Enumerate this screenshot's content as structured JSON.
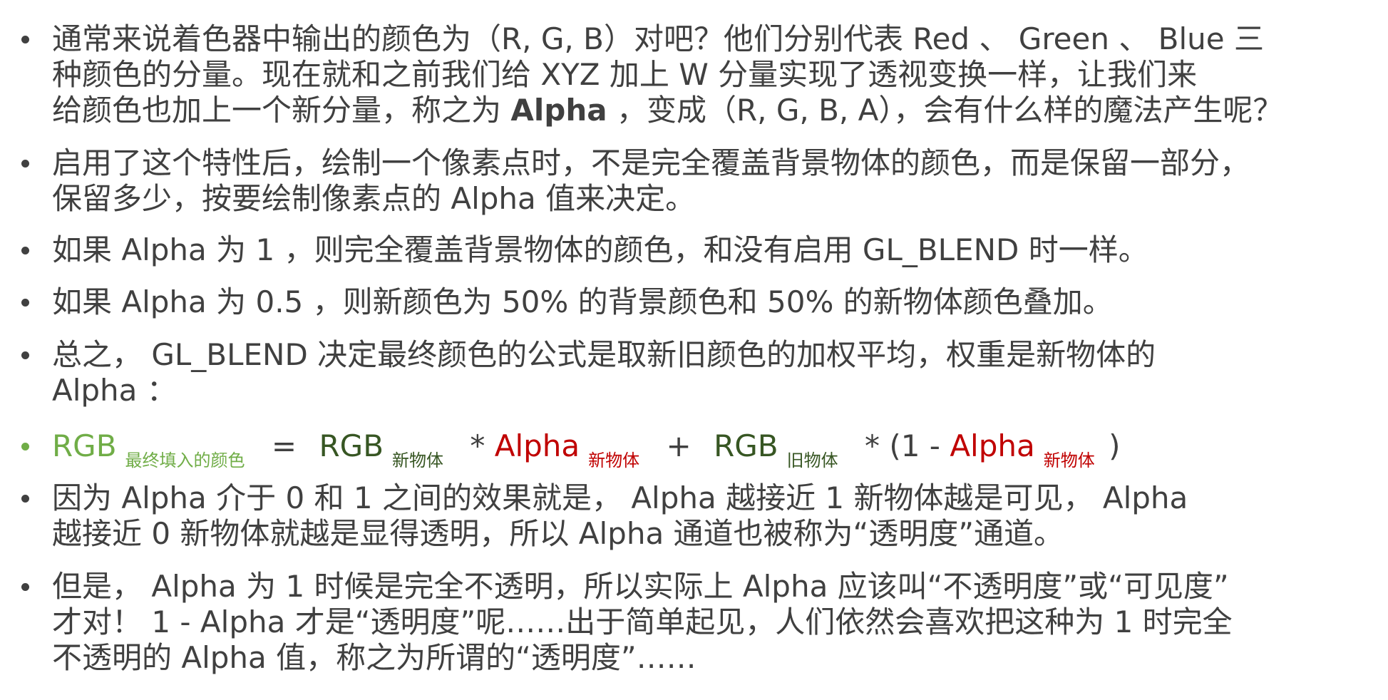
{
  "colors": {
    "text": "#404040",
    "light_green": "#70ad47",
    "dark_green": "#375623",
    "red": "#c00000",
    "bullet_dot": "#404040"
  },
  "bullets": [
    {
      "lines": [
        "通常来说着色器中输出的颜色为（R, G, B）对吧？他们分别代表 Red 、 Green 、 Blue 三",
        "种颜色的分量。现在就和之前我们给 XYZ 加上 W 分量实现了透视变换一样，让我们来"
      ],
      "line3_pre": "给颜色也加上一个新分量，称之为",
      "line3_bold": "Alpha",
      "line3_post": "，变成（R, G, B, A），会有什么样的魔法产生呢？"
    },
    {
      "lines": [
        "启用了这个特性后，绘制一个像素点时，不是完全覆盖背景物体的颜色，而是保留一部分，",
        "保留多少，按要绘制像素点的 Alpha 值来决定。"
      ]
    },
    {
      "lines": [
        "如果 Alpha 为 1 ，则完全覆盖背景物体的颜色，和没有启用 GL_BLEND 时一样。"
      ]
    },
    {
      "lines": [
        "如果 Alpha 为 0.5 ，则新颜色为 50% 的背景颜色和 50% 的新物体颜色叠加。"
      ]
    },
    {
      "lines": [
        "总之， GL_BLEND 决定最终颜色的公式是取新旧颜色的加权平均，权重是新物体的",
        "Alpha ："
      ]
    },
    {
      "lines": [
        "因为 Alpha 介于 0 和 1 之间的效果就是， Alpha 越接近 1 新物体越是可见， Alpha",
        "越接近 0 新物体就越是显得透明，所以 Alpha 通道也被称为“透明度”通道。"
      ]
    },
    {
      "lines": [
        "但是， Alpha 为 1 时候是完全不透明，所以实际上 Alpha 应该叫“不透明度”或“可见度”",
        "才对！ 1 - Alpha 才是“透明度”呢……出于简单起见，人们依然会喜欢把这种为 1 时完全",
        "不透明的 Alpha 值，称之为所谓的“透明度”……"
      ]
    }
  ],
  "formula": {
    "rgb_final": "RGB",
    "rgb_final_sub": "最终填入的颜色",
    "equals": "=",
    "rgb_new": "RGB",
    "rgb_new_sub": "新物体",
    "times1": "*",
    "alpha_new": "Alpha",
    "alpha_new_sub": "新物体",
    "plus": "+",
    "rgb_old": "RGB",
    "rgb_old_sub": "旧物体",
    "times2_open": "* (1 -",
    "alpha_new2": "Alpha",
    "alpha_new2_sub": "新物体",
    "close": ")"
  }
}
